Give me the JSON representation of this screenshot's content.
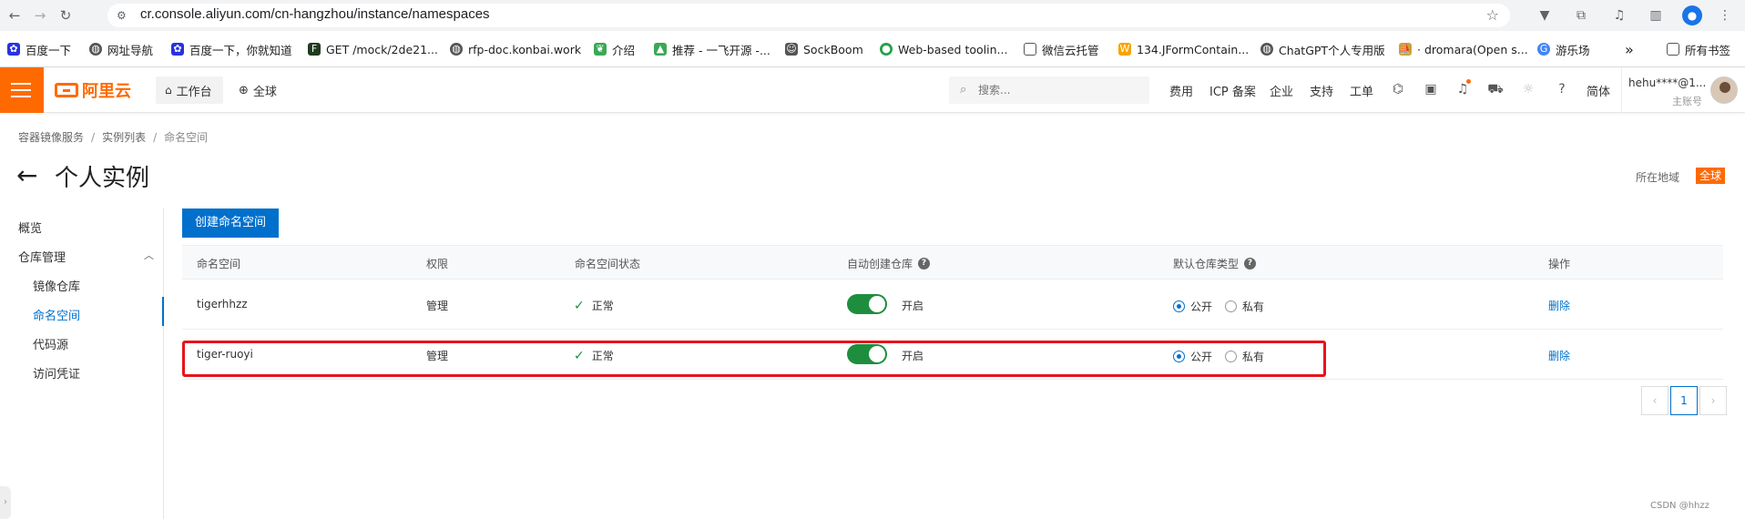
{
  "browser": {
    "url": "cr.console.aliyun.com/cn-hangzhou/instance/namespaces",
    "bookmarks": [
      {
        "label": "百度一下",
        "icon": "baidu-paw-icon",
        "color": "#2932e1"
      },
      {
        "label": "网址导航",
        "icon": "globe-icon",
        "color": "#333333"
      },
      {
        "label": "百度一下，你就知道",
        "icon": "baidu-paw-icon",
        "color": "#2932e1"
      },
      {
        "label": "GET /mock/2de21...",
        "icon": "terminal-icon",
        "color": "#1f3b1f"
      },
      {
        "label": "rfp-doc.konbai.work",
        "icon": "globe-icon",
        "color": "#333333"
      },
      {
        "label": "介绍",
        "icon": "leaf-icon",
        "color": "#3aa856"
      },
      {
        "label": "推荐 - 一飞开源 -...",
        "icon": "mountain-icon",
        "color": "#3aa856"
      },
      {
        "label": "SockBoom",
        "icon": "ghost-icon",
        "color": "#555555"
      },
      {
        "label": "Web-based toolin...",
        "icon": "green-circle-icon",
        "color": "#24a148"
      },
      {
        "label": "微信云托管",
        "icon": "folder-icon",
        "color": "#555555"
      },
      {
        "label": "134.JFormContain...",
        "icon": "w-icon",
        "color": "#f7a400"
      },
      {
        "label": "ChatGPT个人专用版",
        "icon": "globe-icon",
        "color": "#333333"
      },
      {
        "label": "· dromara(Open s...",
        "icon": "boat-icon",
        "color": "#c9a23a"
      },
      {
        "label": "游乐场",
        "icon": "g-icon",
        "color": "#4285f4"
      }
    ],
    "more_label": "»",
    "all_bookmarks": "所有书签"
  },
  "topbar": {
    "brand": "阿里云",
    "workbench": "工作台",
    "region": "全球",
    "search_placeholder": "搜索...",
    "nav": [
      "费用",
      "ICP 备案",
      "企业",
      "支持",
      "工单"
    ],
    "lang": "简体",
    "user_name": "hehu****@1...",
    "user_role": "主账号"
  },
  "breadcrumb": [
    "容器镜像服务",
    "实例列表",
    "命名空间"
  ],
  "page": {
    "title": "个人实例",
    "region_label": "所在地域",
    "region_value": "全球"
  },
  "sidebar": {
    "overview": "概览",
    "repo_manage": "仓库管理",
    "sub_items": [
      "镜像仓库",
      "命名空间",
      "代码源",
      "访问凭证"
    ],
    "active": "命名空间"
  },
  "main": {
    "create_button": "创建命名空间",
    "columns": [
      "命名空间",
      "权限",
      "命名空间状态",
      "自动创建仓库",
      "默认仓库类型",
      "操作"
    ],
    "rows": [
      {
        "namespace": "tigerhhzz",
        "permission": "管理",
        "status": "正常",
        "auto_create": "开启",
        "auto_create_on": true,
        "type_public": "公开",
        "type_private": "私有",
        "selected": "公开",
        "action": "删除"
      },
      {
        "namespace": "tiger-ruoyi",
        "permission": "管理",
        "status": "正常",
        "auto_create": "开启",
        "auto_create_on": true,
        "type_public": "公开",
        "type_private": "私有",
        "selected": "公开",
        "action": "删除"
      }
    ],
    "pager": {
      "prev": "‹",
      "current": "1",
      "next": "›"
    }
  },
  "watermark": "CSDN @hhzz",
  "colors": {
    "brand_orange": "#ff6a00",
    "primary_blue": "#0070cc",
    "toggle_green": "#1e8e3e",
    "highlight_red": "#e8131b"
  }
}
